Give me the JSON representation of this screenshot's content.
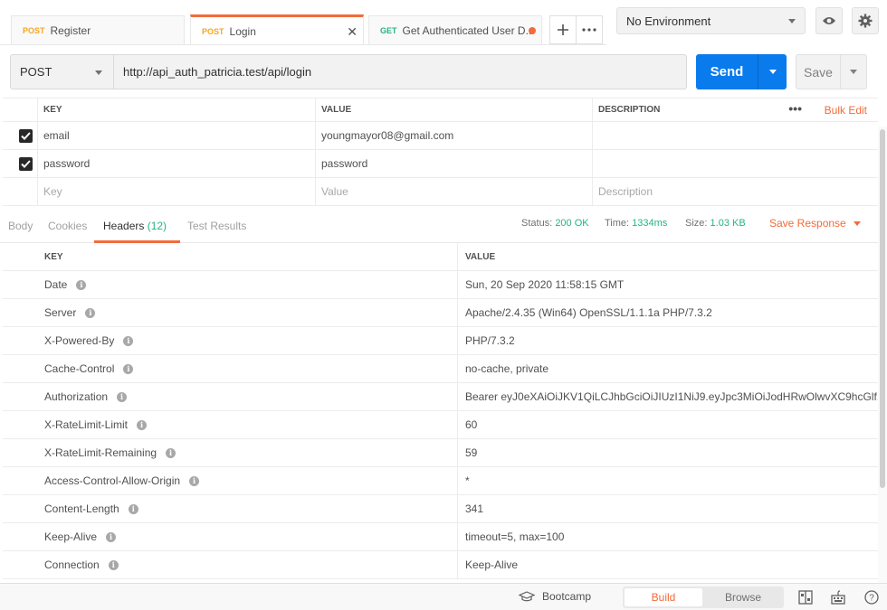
{
  "tabs": [
    {
      "method": "POST",
      "label": "Register"
    },
    {
      "method": "POST",
      "label": "Login"
    },
    {
      "method": "GET",
      "label": "Get Authenticated User D..."
    }
  ],
  "environment": {
    "selected": "No Environment"
  },
  "request": {
    "method": "POST",
    "url": "http://api_auth_patricia.test/api/login",
    "send_label": "Send",
    "save_label": "Save"
  },
  "params": {
    "columns": [
      "KEY",
      "VALUE",
      "DESCRIPTION"
    ],
    "bulk_edit": "Bulk Edit",
    "rows": [
      {
        "key": "email",
        "value": "youngmayor08@gmail.com"
      },
      {
        "key": "password",
        "value": "password"
      }
    ],
    "placeholders": {
      "key": "Key",
      "value": "Value",
      "description": "Description"
    }
  },
  "response": {
    "tabs": {
      "body": "Body",
      "cookies": "Cookies",
      "headers": "Headers",
      "headers_count": "(12)",
      "tests": "Test Results"
    },
    "status_label": "Status:",
    "status": "200 OK",
    "time_label": "Time:",
    "time": "1334ms",
    "size_label": "Size:",
    "size": "1.03 KB",
    "save_response": "Save Response"
  },
  "headers": {
    "columns": [
      "KEY",
      "VALUE"
    ],
    "rows": [
      {
        "key": "Date",
        "value": "Sun, 20 Sep 2020 11:58:15 GMT"
      },
      {
        "key": "Server",
        "value": "Apache/2.4.35 (Win64) OpenSSL/1.1.1a PHP/7.3.2"
      },
      {
        "key": "X-Powered-By",
        "value": "PHP/7.3.2"
      },
      {
        "key": "Cache-Control",
        "value": "no-cache, private"
      },
      {
        "key": "Authorization",
        "value": "Bearer eyJ0eXAiOiJKV1QiLCJhbGciOiJIUzI1NiJ9.eyJpc3MiOiJodHRwOlwvXC9hcGlf..."
      },
      {
        "key": "X-RateLimit-Limit",
        "value": "60"
      },
      {
        "key": "X-RateLimit-Remaining",
        "value": "59"
      },
      {
        "key": "Access-Control-Allow-Origin",
        "value": "*"
      },
      {
        "key": "Content-Length",
        "value": "341"
      },
      {
        "key": "Keep-Alive",
        "value": "timeout=5, max=100"
      },
      {
        "key": "Connection",
        "value": "Keep-Alive"
      }
    ]
  },
  "footer": {
    "bootcamp": "Bootcamp",
    "build": "Build",
    "browse": "Browse"
  },
  "colors": {
    "accent": "#f26b3a",
    "send": "#097bed",
    "ok": "#26b47f",
    "post": "#f5a623"
  }
}
